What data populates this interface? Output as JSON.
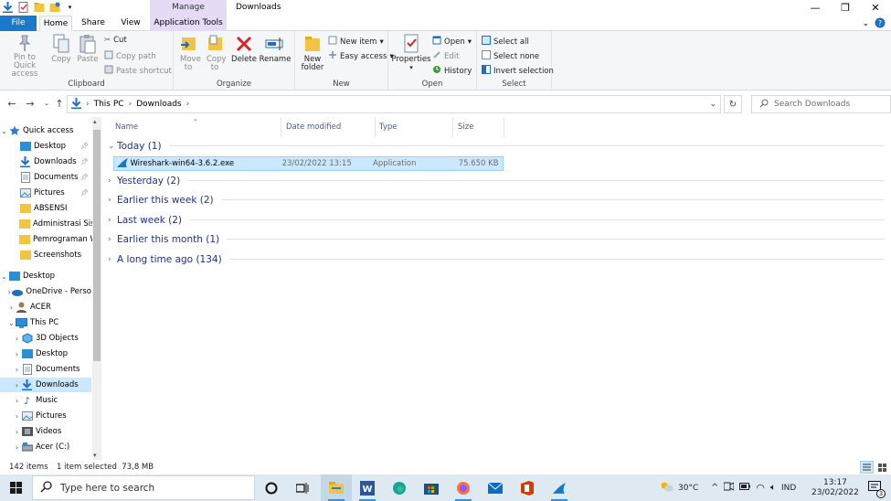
{
  "window": {
    "title": "Downloads",
    "contextual_tab_header": "Manage",
    "controls": {
      "minimize": "—",
      "maximize": "❐",
      "close": "✕"
    }
  },
  "ribbon_tabs": [
    "File",
    "Home",
    "Share",
    "View",
    "Application Tools"
  ],
  "ribbon": {
    "clipboard": {
      "label": "Clipboard",
      "pin": "Pin to Quick access",
      "copy": "Copy",
      "paste": "Paste",
      "cut": "Cut",
      "copy_path": "Copy path",
      "paste_shortcut": "Paste shortcut"
    },
    "organize": {
      "label": "Organize",
      "move_to": "Move to",
      "copy_to": "Copy to",
      "delete": "Delete",
      "rename": "Rename"
    },
    "new": {
      "label": "New",
      "new_folder": "New folder",
      "new_item": "New item",
      "easy_access": "Easy access"
    },
    "open": {
      "label": "Open",
      "properties": "Properties",
      "open": "Open",
      "edit": "Edit",
      "history": "History"
    },
    "select": {
      "label": "Select",
      "select_all": "Select all",
      "select_none": "Select none",
      "invert": "Invert selection"
    }
  },
  "address": {
    "path": [
      "This PC",
      "Downloads"
    ],
    "search_placeholder": "Search Downloads"
  },
  "nav": {
    "quick_access": "Quick access",
    "quick_items": [
      {
        "label": "Desktop",
        "pinned": true
      },
      {
        "label": "Downloads",
        "pinned": true
      },
      {
        "label": "Documents",
        "pinned": true
      },
      {
        "label": "Pictures",
        "pinned": true
      },
      {
        "label": "ABSENSI",
        "pinned": false
      },
      {
        "label": "Administrasi Sist",
        "pinned": false
      },
      {
        "label": "Pemrograman W",
        "pinned": false
      },
      {
        "label": "Screenshots",
        "pinned": false
      }
    ],
    "desktop": "Desktop",
    "onedrive": "OneDrive - Perso",
    "acer": "ACER",
    "this_pc": "This PC",
    "pc_items": [
      "3D Objects",
      "Desktop",
      "Documents",
      "Downloads",
      "Music",
      "Pictures",
      "Videos",
      "Acer (C:)"
    ]
  },
  "columns": {
    "name": "Name",
    "date": "Date modified",
    "type": "Type",
    "size": "Size"
  },
  "groups": [
    "Today (1)",
    "Yesterday (2)",
    "Earlier this week (2)",
    "Last week (2)",
    "Earlier this month (1)",
    "A long time ago (134)"
  ],
  "file": {
    "name": "Wireshark-win64-3.6.2.exe",
    "date": "23/02/2022 13:15",
    "type": "Application",
    "size": "75.650 KB"
  },
  "status": {
    "items": "142 items",
    "selected": "1 item selected  73,8 MB"
  },
  "taskbar": {
    "search_placeholder": "Type here to search",
    "temperature": "30°C",
    "lang": "IND",
    "time": "13:17",
    "date": "23/02/2022",
    "notif_count": "3"
  }
}
